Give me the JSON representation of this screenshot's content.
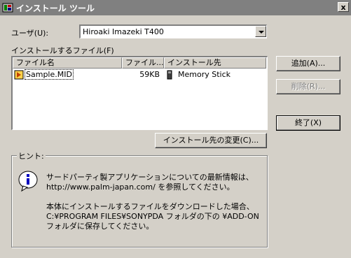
{
  "window": {
    "title": "インストール ツール",
    "close_label": "x"
  },
  "user": {
    "label": "ユーザ(U):",
    "selected_value": "Hiroaki Imazeki T400"
  },
  "files": {
    "label": "インストールするファイル(F)",
    "columns": [
      "ファイル名",
      "ファイル...",
      "インストール先"
    ],
    "rows": [
      {
        "name": "Sample.MID",
        "size": "59KB",
        "destination": "Memory Stick"
      }
    ]
  },
  "buttons": {
    "add": "追加(A)...",
    "delete": "削除(R)...",
    "exit": "終了(X)",
    "change_destination": "インストール先の変更(C)..."
  },
  "hint": {
    "group_label": "ヒント:",
    "lines": [
      "サードパーティ製アプリケーションについての最新情報は、",
      "http://www.palm-japan.com/ を参照してください。",
      "",
      "本体にインストールするファイルをダウンロードした場合、",
      "C:¥PROGRAM FILES¥SONYPDA フォルダの下の ¥ADD-ON",
      "フォルダに保存してください。"
    ]
  },
  "icons": {
    "app": "install-tool-icon",
    "file": "midi-file-icon",
    "destination": "memory-stick-icon",
    "info": "info-icon"
  }
}
